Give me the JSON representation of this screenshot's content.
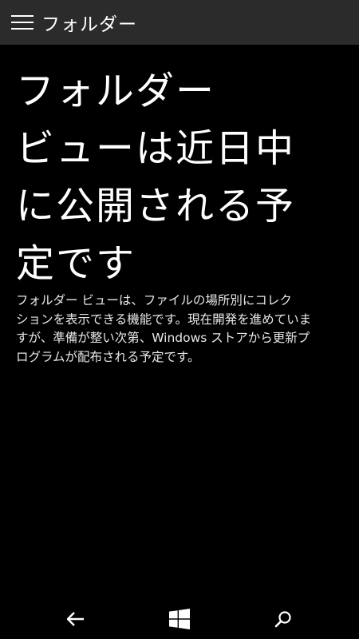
{
  "app_bar": {
    "menu_icon": "hamburger-menu-icon",
    "title": "フォルダー"
  },
  "main": {
    "headline_lines": [
      "フォルダー",
      "ビューは近日中",
      "に公開される予",
      "定です"
    ],
    "description_lines": [
      "フォルダー ビューは、ファイルの場所別にコレク",
      "ションを表示できる機能です。現在開発を進めていま",
      "すが、準備が整い次第、Windows ストアから更新プ",
      "ログラムが配布される予定です。"
    ]
  },
  "nav_bar": {
    "back_icon": "back-arrow-icon",
    "start_icon": "windows-logo-icon",
    "search_icon": "search-icon"
  }
}
